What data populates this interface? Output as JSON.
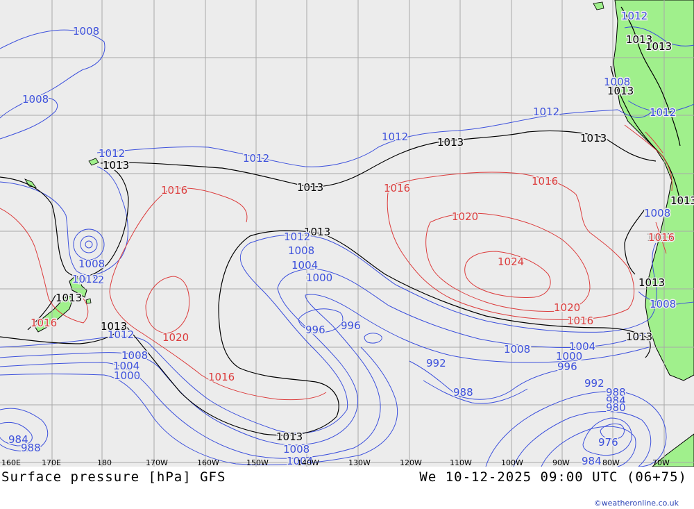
{
  "footer": {
    "title": "Surface pressure [hPa] GFS",
    "date": "We 10-12-2025 09:00 UTC (06+75)",
    "credit": "©weatheronline.co.uk"
  },
  "map": {
    "colors": {
      "sea": "#ececec",
      "land": "#a0f08c",
      "grid": "#a8a8a8",
      "isobar_low": "#3c50dc",
      "isobar_standard": "#000000",
      "isobar_high": "#dc3c3c"
    },
    "longitude_labels": [
      "160E",
      "170E",
      "180",
      "170W",
      "160W",
      "150W",
      "140W",
      "130W",
      "120W",
      "110W",
      "100W",
      "90W",
      "80W",
      "70W"
    ],
    "isobar_labels": [
      {
        "text": "1008",
        "color": "blue"
      },
      {
        "text": "1008",
        "color": "blue"
      },
      {
        "text": "1012",
        "color": "blue"
      },
      {
        "text": "1013",
        "color": "black"
      },
      {
        "text": "1012",
        "color": "blue"
      },
      {
        "text": "1013",
        "color": "black"
      },
      {
        "text": "1012",
        "color": "blue"
      },
      {
        "text": "1013",
        "color": "black"
      },
      {
        "text": "1012",
        "color": "blue"
      },
      {
        "text": "1013",
        "color": "black"
      },
      {
        "text": "1012",
        "color": "blue"
      },
      {
        "text": "1013",
        "color": "black"
      },
      {
        "text": "1013",
        "color": "black"
      },
      {
        "text": "1008",
        "color": "blue"
      },
      {
        "text": "1013",
        "color": "black"
      },
      {
        "text": "1012",
        "color": "blue"
      },
      {
        "text": "1008",
        "color": "blue"
      },
      {
        "text": "1013",
        "color": "black"
      },
      {
        "text": "1013",
        "color": "black"
      },
      {
        "text": "1016",
        "color": "red"
      },
      {
        "text": "1016",
        "color": "red"
      },
      {
        "text": "1016",
        "color": "red"
      },
      {
        "text": "1020",
        "color": "red"
      },
      {
        "text": "1024",
        "color": "red"
      },
      {
        "text": "1013",
        "color": "black"
      },
      {
        "text": "1016",
        "color": "red"
      },
      {
        "text": "1012",
        "color": "blue"
      },
      {
        "text": "1008",
        "color": "blue"
      },
      {
        "text": "1012",
        "color": "blue"
      },
      {
        "text": "1008",
        "color": "blue"
      },
      {
        "text": "1004",
        "color": "blue"
      },
      {
        "text": "1000",
        "color": "blue"
      },
      {
        "text": "996",
        "color": "blue"
      },
      {
        "text": "996",
        "color": "blue"
      },
      {
        "text": "1008",
        "color": "blue"
      },
      {
        "text": "1012",
        "color": "blue"
      },
      {
        "text": "1013",
        "color": "black"
      },
      {
        "text": "1016",
        "color": "red"
      },
      {
        "text": "1013",
        "color": "black"
      },
      {
        "text": "1012",
        "color": "blue"
      },
      {
        "text": "1008",
        "color": "blue"
      },
      {
        "text": "1004",
        "color": "blue"
      },
      {
        "text": "1000",
        "color": "blue"
      },
      {
        "text": "1020",
        "color": "red"
      },
      {
        "text": "1016",
        "color": "red"
      },
      {
        "text": "1020",
        "color": "red"
      },
      {
        "text": "1016",
        "color": "red"
      },
      {
        "text": "1008",
        "color": "blue"
      },
      {
        "text": "1004",
        "color": "blue"
      },
      {
        "text": "1000",
        "color": "blue"
      },
      {
        "text": "996",
        "color": "blue"
      },
      {
        "text": "992",
        "color": "blue"
      },
      {
        "text": "988",
        "color": "blue"
      },
      {
        "text": "992",
        "color": "blue"
      },
      {
        "text": "988",
        "color": "blue"
      },
      {
        "text": "984",
        "color": "blue"
      },
      {
        "text": "980",
        "color": "blue"
      },
      {
        "text": "976",
        "color": "blue"
      },
      {
        "text": "984",
        "color": "blue"
      },
      {
        "text": "1013",
        "color": "black"
      },
      {
        "text": "1008",
        "color": "blue"
      },
      {
        "text": "1004",
        "color": "blue"
      },
      {
        "text": "984",
        "color": "blue"
      },
      {
        "text": "988",
        "color": "blue"
      },
      {
        "text": "1013",
        "color": "black"
      },
      {
        "text": "1008",
        "color": "blue"
      },
      {
        "text": "1013",
        "color": "black"
      }
    ]
  }
}
